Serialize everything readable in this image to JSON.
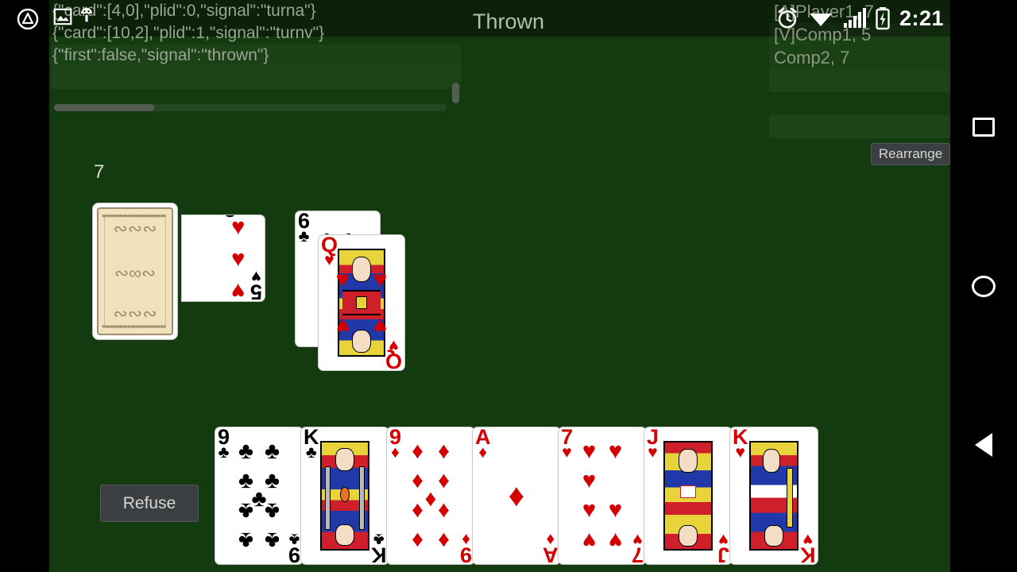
{
  "app": {
    "title": "Thrown",
    "table_color": "#133b0f",
    "statusbar_color": "#0b2208"
  },
  "status_bar": {
    "clock": "2:21",
    "icons": [
      "alarm-icon",
      "wifi-icon",
      "signal-icon",
      "battery-charging-icon"
    ],
    "notification_icons": [
      "screenshot-image-icon",
      "android-robot-icon"
    ],
    "left_badge_icon": "app-triangle-badge-icon"
  },
  "log_panel": {
    "lines": [
      "{\"card\":[4,0],\"plid\":0,\"signal\":\"turna\"}",
      "{\"card\":[10,2],\"plid\":1,\"signal\":\"turnv\"}",
      "{\"first\":false,\"signal\":\"thrown\"}"
    ],
    "scrollbar_horizontal": "log-hscrollbar",
    "scrollbar_vertical": "log-vscrollbar"
  },
  "scoreboard": {
    "rows": [
      "[A]Player1, 7",
      "[V]Comp1, 5",
      "Comp2, 7"
    ]
  },
  "buttons": {
    "rearrange": "Rearrange",
    "refuse": "Refuse"
  },
  "table": {
    "deck_count": "7",
    "deck_back_label": "card-back",
    "trump_card": {
      "rank": "5",
      "suit": "♥",
      "color": "red",
      "name": "five-of-hearts"
    },
    "pile": [
      {
        "rank": "6",
        "suit": "♣",
        "color": "black",
        "name": "six-of-clubs",
        "court": false
      },
      {
        "rank": "Q",
        "suit": "♥",
        "color": "red",
        "name": "queen-of-hearts",
        "court": true
      }
    ]
  },
  "hand": {
    "cards": [
      {
        "rank": "9",
        "suit": "♣",
        "color": "black",
        "name": "nine-of-clubs",
        "court": false
      },
      {
        "rank": "K",
        "suit": "♣",
        "color": "black",
        "name": "king-of-clubs",
        "court": true
      },
      {
        "rank": "9",
        "suit": "♦",
        "color": "red",
        "name": "nine-of-diamonds",
        "court": false
      },
      {
        "rank": "A",
        "suit": "♦",
        "color": "red",
        "name": "ace-of-diamonds",
        "court": false
      },
      {
        "rank": "7",
        "suit": "♥",
        "color": "red",
        "name": "seven-of-hearts",
        "court": false
      },
      {
        "rank": "J",
        "suit": "♥",
        "color": "red",
        "name": "jack-of-hearts",
        "court": true
      },
      {
        "rank": "K",
        "suit": "♥",
        "color": "red",
        "name": "king-of-hearts",
        "court": true
      }
    ]
  },
  "nav_bar": {
    "items": [
      "recent-apps-icon",
      "home-icon",
      "back-icon"
    ]
  }
}
